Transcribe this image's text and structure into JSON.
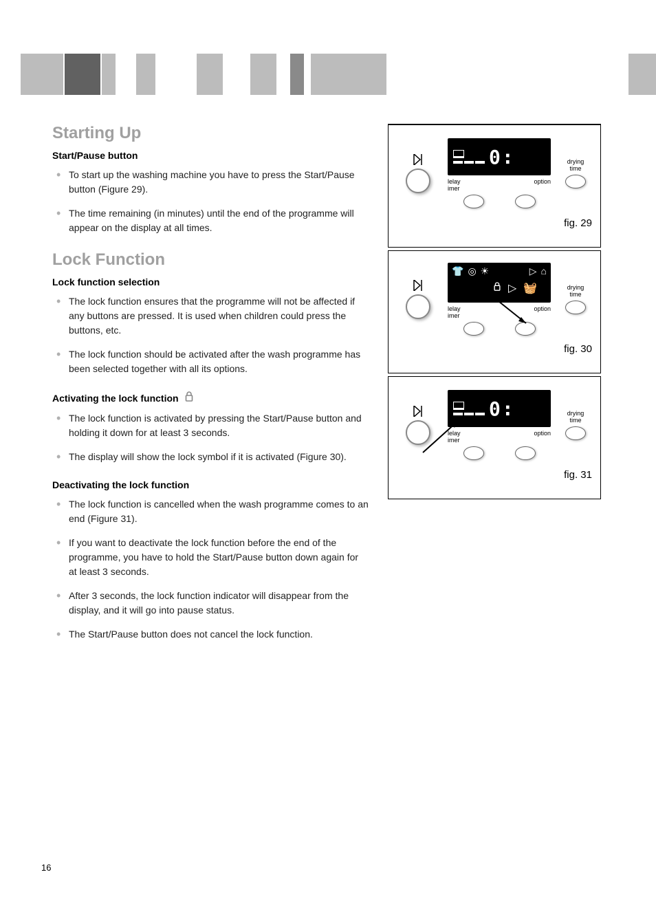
{
  "page_number": "16",
  "sections": {
    "starting_up": {
      "title": "Starting Up",
      "sub1": "Start/Pause button",
      "bullets1": [
        "To start up the washing machine you have to press the Start/Pause button (Figure 29).",
        "The time remaining (in minutes) until the end of the programme will appear on the display at all times."
      ]
    },
    "lock_function": {
      "title": "Lock Function",
      "sub1": "Lock function selection",
      "bullets1": [
        "The lock function ensures that the programme will not be affected if any buttons are pressed. It is used when children could press the buttons, etc.",
        "The lock function should be activated after the wash programme has been selected together with all its options."
      ],
      "sub2": "Activating the lock function",
      "bullets2": [
        "The lock function is activated by pressing the Start/Pause button and holding it down for at least 3 seconds.",
        "The display will show the lock symbol if it is activated (Figure 30)."
      ],
      "sub3": "Deactivating the lock function",
      "bullets3": [
        "The lock function is cancelled when the wash programme comes to an end (Figure 31).",
        "If you want to deactivate the lock function before the end of the programme, you have to hold the Start/Pause button down again for at least 3 seconds.",
        "After 3 seconds, the lock function indicator will disappear from the display, and it will go into pause status.",
        "The Start/Pause button does not cancel the lock function."
      ]
    }
  },
  "figures": {
    "fig29": {
      "label": "fig. 29",
      "lcd_value": "0:",
      "label_delay": "lelay",
      "label_timer": "imer",
      "label_option": "option",
      "label_drying": "drying",
      "label_time": "time"
    },
    "fig30": {
      "label": "fig. 30",
      "label_delay": "lelay",
      "label_timer": "imer",
      "label_option": "option",
      "label_drying": "drying",
      "label_time": "time"
    },
    "fig31": {
      "label": "fig. 31",
      "lcd_value": "0:",
      "label_delay": "lelay",
      "label_timer": "imer",
      "label_option": "option",
      "label_drying": "drying",
      "label_time": "time"
    }
  }
}
